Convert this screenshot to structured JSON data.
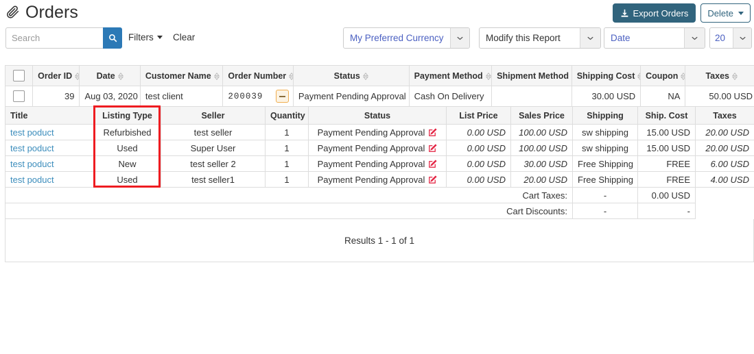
{
  "header": {
    "icon": "paperclip-icon",
    "title": "Orders",
    "export_label": "Export Orders",
    "export_icon": "download-icon",
    "delete_label": "Delete",
    "accent_export_bg": "#31647d"
  },
  "controls": {
    "search_placeholder": "Search",
    "search_value": "",
    "search_icon": "search-icon",
    "filters_label": "Filters",
    "clear_label": "Clear",
    "currency_value": "My Preferred Currency",
    "report_value": "Modify this Report",
    "sort_value": "Date",
    "page_size_value": "20"
  },
  "master_table": {
    "headers": [
      {
        "label": "",
        "sortable": false
      },
      {
        "label": "Order ID",
        "sortable": true
      },
      {
        "label": "Date",
        "sortable": true
      },
      {
        "label": "Customer Name",
        "sortable": true
      },
      {
        "label": "Order Number",
        "sortable": true
      },
      {
        "label": "Status",
        "sortable": true
      },
      {
        "label": "Payment Method",
        "sortable": true
      },
      {
        "label": "Shipment Method",
        "sortable": true
      },
      {
        "label": "Shipping Cost",
        "sortable": true
      },
      {
        "label": "Coupon",
        "sortable": true
      },
      {
        "label": "Taxes",
        "sortable": true
      }
    ],
    "row": {
      "order_id": "39",
      "date": "Aug 03, 2020",
      "customer_name": "test client",
      "order_number": "200039",
      "status": "Payment Pending Approval",
      "payment_method": "Cash On Delivery",
      "shipment_method": "",
      "shipping_cost": "30.00 USD",
      "coupon": "NA",
      "taxes": "50.00 USD",
      "collapse_icon": "minus-icon"
    }
  },
  "detail_table": {
    "headers": [
      "Title",
      "Listing Type",
      "Seller",
      "Quantity",
      "Status",
      "List Price",
      "Sales Price",
      "Shipping",
      "Ship. Cost",
      "Taxes"
    ],
    "rows": [
      {
        "title": "test poduct",
        "listing_type": "Refurbished",
        "seller": "test seller",
        "quantity": "1",
        "status": "Payment Pending Approval",
        "status_icon": "edit-icon",
        "list_price": "0.00 USD",
        "sales_price": "100.00 USD",
        "shipping": "sw shipping",
        "ship_cost": "15.00 USD",
        "taxes": "20.00 USD"
      },
      {
        "title": "test poduct",
        "listing_type": "Used",
        "seller": "Super User",
        "quantity": "1",
        "status": "Payment Pending Approval",
        "status_icon": "edit-icon",
        "list_price": "0.00 USD",
        "sales_price": "100.00 USD",
        "shipping": "sw shipping",
        "ship_cost": "15.00 USD",
        "taxes": "20.00 USD"
      },
      {
        "title": "test poduct",
        "listing_type": "New",
        "seller": "test seller 2",
        "quantity": "1",
        "status": "Payment Pending Approval",
        "status_icon": "edit-icon",
        "list_price": "0.00 USD",
        "sales_price": "30.00 USD",
        "shipping": "Free Shipping",
        "ship_cost": "FREE",
        "taxes": "6.00 USD"
      },
      {
        "title": "test poduct",
        "listing_type": "Used",
        "seller": "test seller1",
        "quantity": "1",
        "status": "Payment Pending Approval",
        "status_icon": "edit-icon",
        "list_price": "0.00 USD",
        "sales_price": "20.00 USD",
        "shipping": "Free Shipping",
        "ship_cost": "FREE",
        "taxes": "4.00 USD"
      }
    ],
    "footer": [
      {
        "label": "Cart Taxes:",
        "ship_cost": "-",
        "taxes": "0.00 USD"
      },
      {
        "label": "Cart Discounts:",
        "ship_cost": "-",
        "taxes": "-"
      }
    ]
  },
  "highlight": {
    "color": "#ee1c21",
    "target": "Listing Type"
  },
  "results_text": "Results 1 - 1 of 1"
}
